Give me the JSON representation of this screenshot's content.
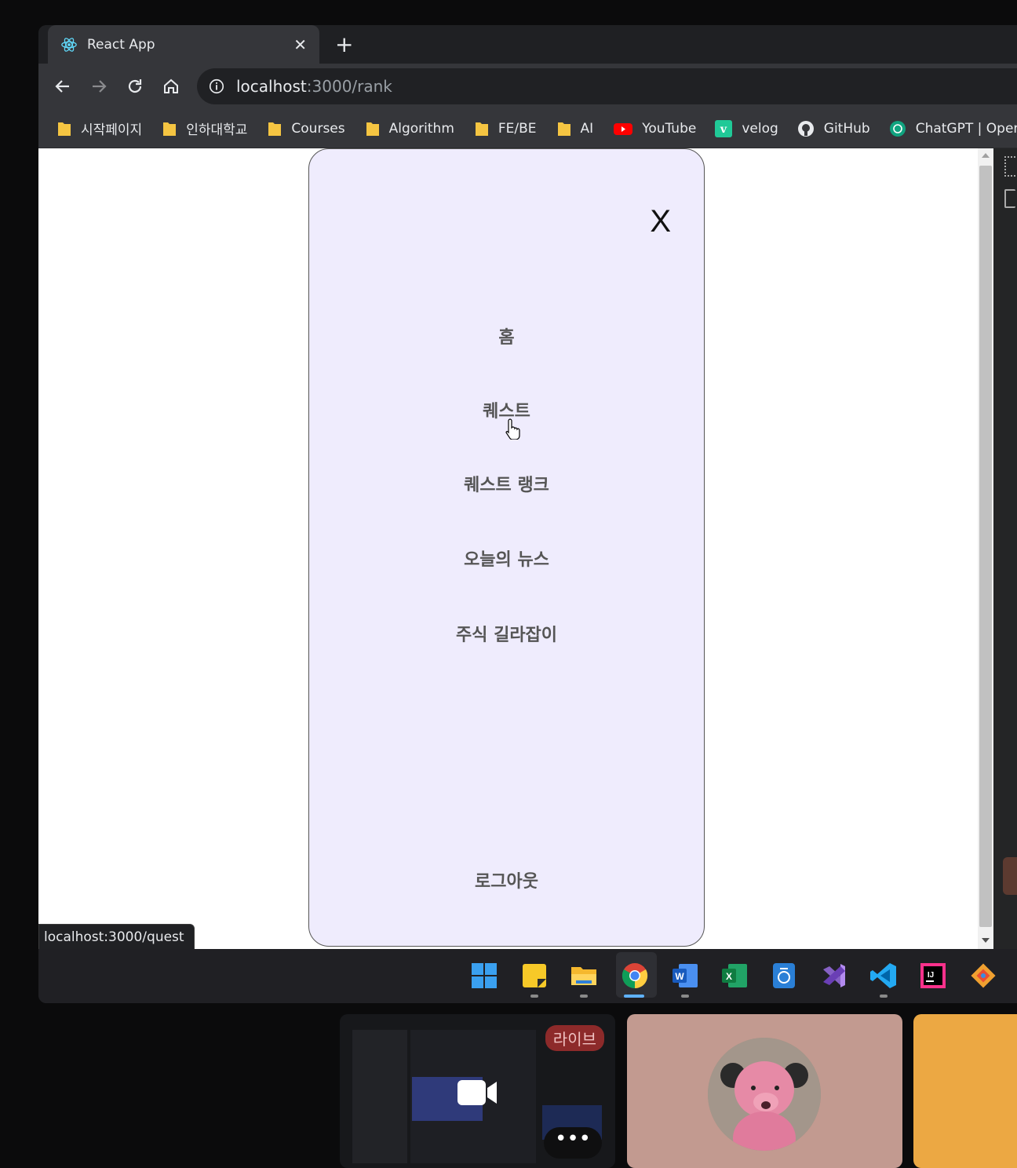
{
  "browser": {
    "tab_title": "React App",
    "url_host": "localhost",
    "url_path": ":3000/rank",
    "bookmarks": [
      "시작페이지",
      "인하대학교",
      "Courses",
      "Algorithm",
      "FE/BE",
      "AI",
      "YouTube",
      "velog",
      "GitHub",
      "ChatGPT | OpenA"
    ]
  },
  "menu": {
    "close_label": "X",
    "items": [
      "홈",
      "퀘스트",
      "퀘스트 랭크",
      "오늘의 뉴스",
      "주식 길라잡이"
    ],
    "logout": "로그아웃"
  },
  "status_url": "localhost:3000/quest",
  "call": {
    "live_label": "라이브"
  },
  "colors": {
    "menu_bg": "#efecfd",
    "menu_text": "#555555",
    "youtube_red": "#ff0000",
    "velog_green": "#20c997"
  }
}
